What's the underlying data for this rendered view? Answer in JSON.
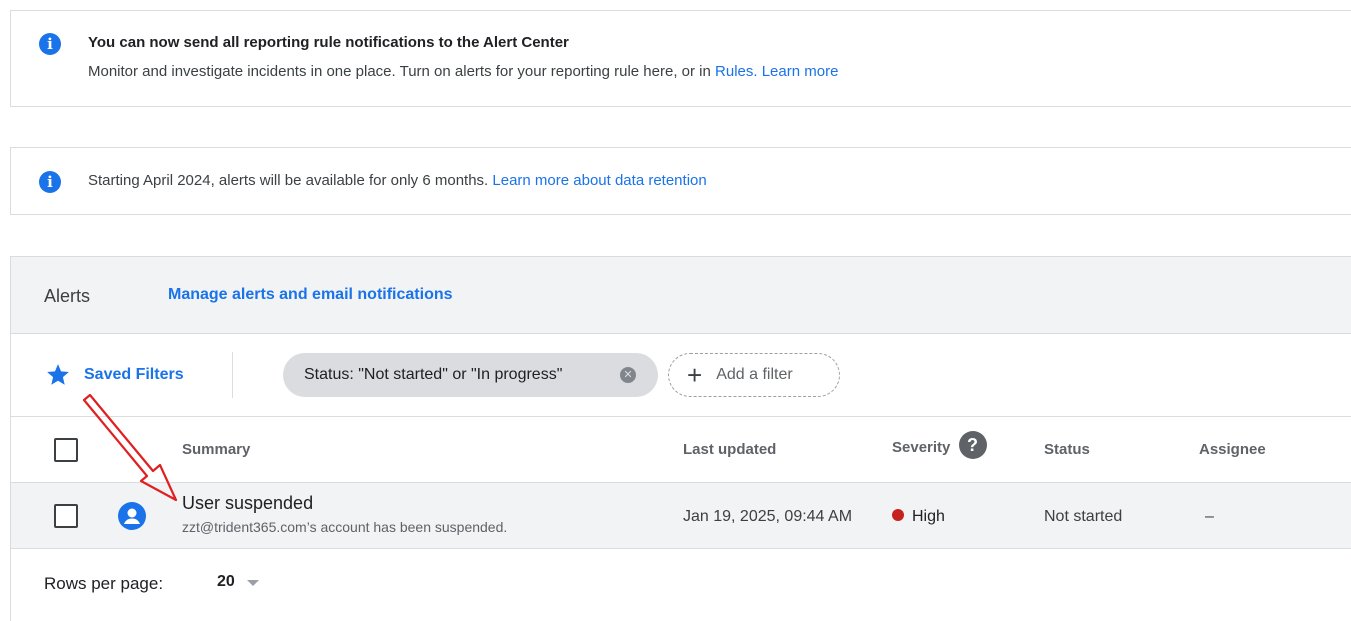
{
  "banners": [
    {
      "title": "You can now send all reporting rule notifications to the Alert Center",
      "text": "Monitor and investigate incidents in one place. Turn on alerts for your reporting rule here, or in ",
      "link1": "Rules.",
      "link2": "Learn more",
      "icon": "info-icon"
    },
    {
      "text": "Starting April 2024, alerts will be available for only 6 months. ",
      "link1": "Learn more about data retention",
      "icon": "info-icon"
    }
  ],
  "panel": {
    "title": "Alerts",
    "manage_link": "Manage alerts and email notifications"
  },
  "filters": {
    "saved_label": "Saved Filters",
    "active_chip": "Status: \"Not started\" or \"In progress\"",
    "add_filter": "Add a filter",
    "add_icon": "+"
  },
  "table": {
    "columns": {
      "summary": "Summary",
      "last_updated": "Last updated",
      "severity": "Severity",
      "status": "Status",
      "assignee": "Assignee"
    },
    "rows": [
      {
        "title": "User suspended",
        "subtitle": "zzt@trident365.com’s account has been suspended.",
        "last_updated": "Jan 19, 2025, 09:44 AM",
        "severity": "High",
        "status": "Not started",
        "assignee": "–"
      }
    ]
  },
  "pagination": {
    "rows_per_page_label": "Rows per page:",
    "rows_per_page_value": "20"
  },
  "colors": {
    "accent": "#1a73e8",
    "severity_high": "#c5221f",
    "annotation_arrow": "#e02020"
  }
}
